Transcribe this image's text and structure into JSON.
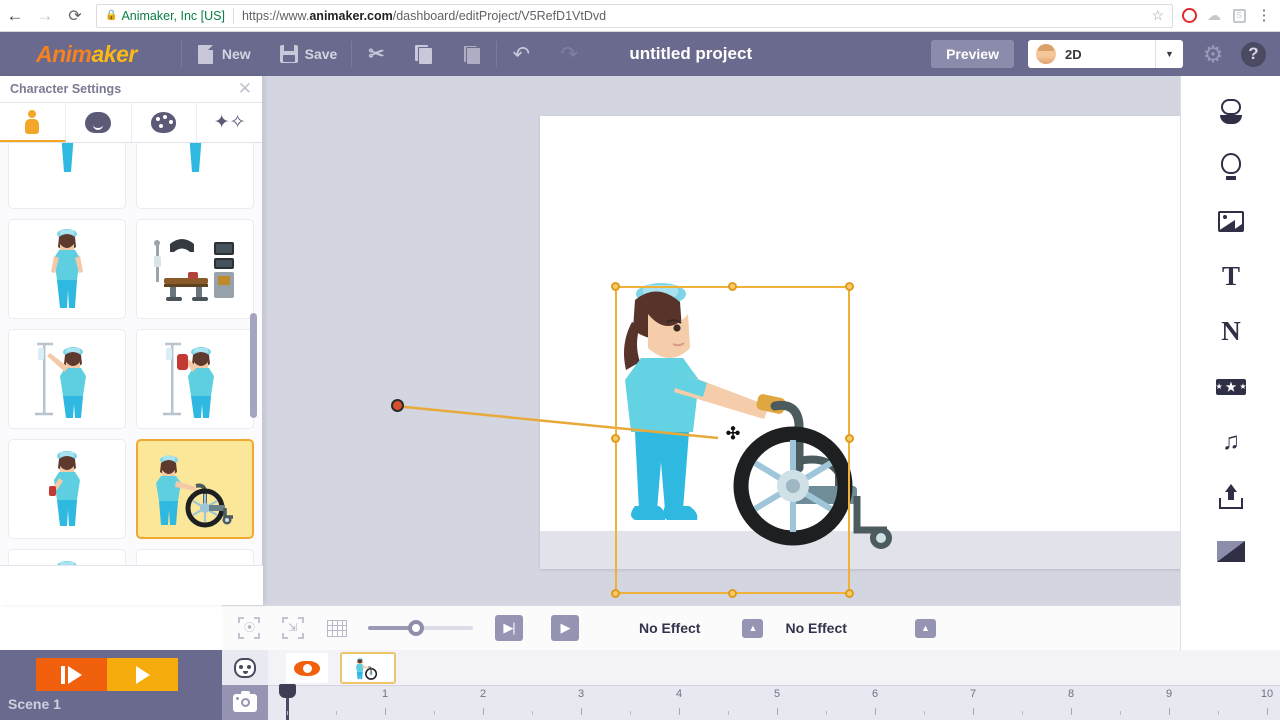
{
  "browser": {
    "back_icon": "back-arrow-icon",
    "forward_icon": "forward-arrow-icon",
    "reload_icon": "reload-icon",
    "lock_icon": "lock-icon",
    "site_identity": "Animaker, Inc [US]",
    "url_scheme": "https://www.",
    "url_domain": "animaker.com",
    "url_path": "/dashboard/editProject/V5RefD1VtDvd",
    "bookmark_icon": "star-icon",
    "extensions": [
      "opera-icon",
      "cloud-icon",
      "screenshot-icon"
    ],
    "menu_icon": "kebab-menu-icon"
  },
  "toolbar": {
    "logo_part1": "Anim",
    "logo_part2": "aker",
    "new_label": "New",
    "save_label": "Save",
    "cut_icon": "scissors-icon",
    "copy_icon": "copy-icon",
    "paste_icon": "paste-icon",
    "undo_icon": "undo-arrow-icon",
    "redo_icon": "redo-arrow-icon",
    "project_title": "untitled project",
    "preview_label": "Preview",
    "mode_label": "2D",
    "mode_caret_icon": "chevron-down-icon",
    "settings_icon": "gear-icon",
    "help_icon": "help-icon",
    "colors": {
      "bar": "#6a6a8e",
      "logo_orange": "#f5821f",
      "logo_amber": "#fdb913"
    }
  },
  "left_panel": {
    "title": "Character Settings",
    "close_icon": "close-icon",
    "tabs": [
      {
        "name": "body",
        "icon": "body-icon",
        "active": true
      },
      {
        "name": "face",
        "icon": "head-icon",
        "active": false
      },
      {
        "name": "color",
        "icon": "palette-icon",
        "active": false
      },
      {
        "name": "effects",
        "icon": "magic-wand-icon",
        "active": false
      }
    ],
    "thumbnails": [
      {
        "id": 1,
        "kind": "nurse-legs-partial",
        "selected": false
      },
      {
        "id": 2,
        "kind": "nurse-legs-partial",
        "selected": false
      },
      {
        "id": 3,
        "kind": "nurse-standing",
        "selected": false
      },
      {
        "id": 4,
        "kind": "operating-table",
        "selected": false
      },
      {
        "id": 5,
        "kind": "nurse-iv-stand",
        "selected": false
      },
      {
        "id": 6,
        "kind": "nurse-blood-bag",
        "selected": false
      },
      {
        "id": 7,
        "kind": "nurse-clipboard",
        "selected": false
      },
      {
        "id": 8,
        "kind": "nurse-wheelchair",
        "selected": true
      },
      {
        "id": 9,
        "kind": "nurse-syringe",
        "selected": false
      },
      {
        "id": 10,
        "kind": "nurse-arms-up",
        "selected": false
      }
    ],
    "selected_thumbnail": "nurse-wheelchair"
  },
  "canvas": {
    "background_color": "#d3d5e1",
    "page_color": "#ffffff",
    "selection": {
      "color": "#f0b13a",
      "handle_count": 8,
      "move_cursor_icon": "move-cursor-icon"
    },
    "motion_path": {
      "anchor_icon": "path-anchor-point",
      "anchor_color": "#d9512c"
    },
    "scene_object": "nurse-pushing-wheelchair"
  },
  "bottom_toolbar": {
    "center_icon": "center-object-icon",
    "fit_icon": "fit-to-screen-icon",
    "grid_icon": "grid-icon",
    "zoom_value": 45,
    "entry_play_icon": "entry-effect-icon",
    "exit_play_icon": "exit-effect-icon",
    "entry_effect": "No Effect",
    "exit_effect": "No Effect",
    "caret_icon": "caret-up-icon"
  },
  "bottom_bar": {
    "step_play_icon": "step-play-icon",
    "play_icon": "play-icon",
    "scene_label": "Scene 1",
    "tab_character_icon": "character-tab-icon",
    "tab_camera_icon": "camera-tab-icon",
    "visibility_icon": "eye-icon",
    "clip_thumbnail": "nurse-wheelchair-clip",
    "playhead_icon": "playhead-icon",
    "ruler_ticks": [
      "1",
      "2",
      "3",
      "4",
      "5",
      "6",
      "7",
      "8",
      "9",
      "10"
    ]
  },
  "right_sidebar": {
    "items": [
      {
        "name": "character",
        "icon": "character-icon"
      },
      {
        "name": "prop",
        "icon": "bulb-icon"
      },
      {
        "name": "image",
        "icon": "image-icon"
      },
      {
        "name": "text",
        "icon": "text-t-icon",
        "glyph": "T"
      },
      {
        "name": "number",
        "icon": "text-n-icon",
        "glyph": "N"
      },
      {
        "name": "effects",
        "icon": "stars-icon"
      },
      {
        "name": "music",
        "icon": "music-note-icon",
        "glyph": "♫"
      },
      {
        "name": "upload",
        "icon": "upload-icon"
      },
      {
        "name": "background",
        "icon": "background-icon"
      }
    ]
  }
}
